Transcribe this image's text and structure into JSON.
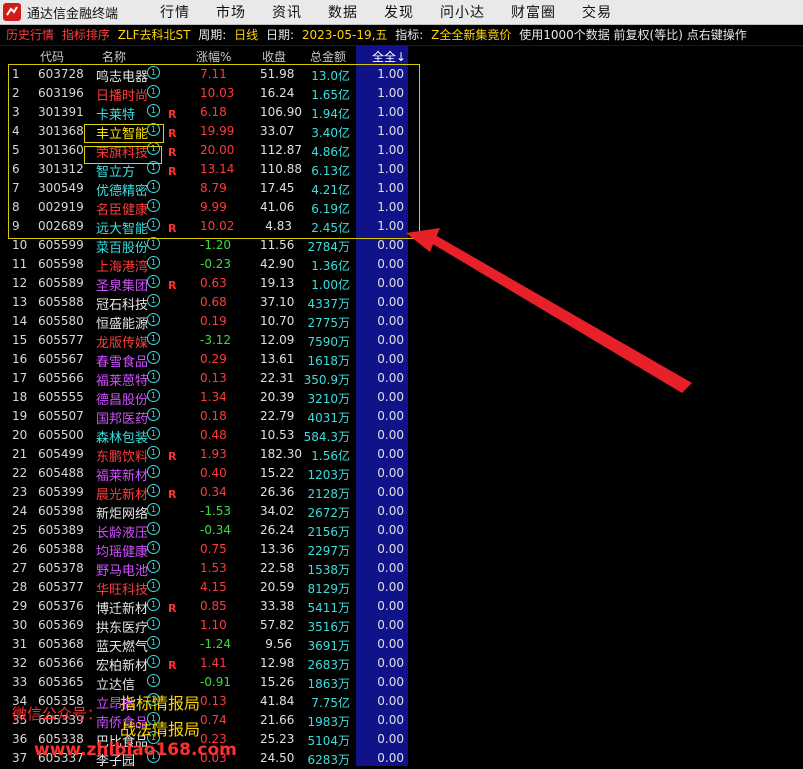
{
  "app": {
    "title": "通达信金融终端"
  },
  "menu": [
    "行情",
    "市场",
    "资讯",
    "数据",
    "发现",
    "问小达",
    "财富圈",
    "交易"
  ],
  "infobar": {
    "history": "历史行情",
    "sort": "指标排序",
    "indicator_name": "ZLF去科北ST",
    "period_label": "周期:",
    "period_value": "日线",
    "date_label": "日期:",
    "date_value": "2023-05-19,五",
    "indicator_label": "指标:",
    "indicator_value": "Z全全新集竟价",
    "note": "使用1000个数据 前复权(等比) 点右键操作"
  },
  "columns": {
    "code": "代码",
    "name": "名称",
    "chg": "涨幅%",
    "close": "收盘",
    "amount": "总金额",
    "all": "全全↓"
  },
  "rows": [
    {
      "n": "1",
      "code": "603728",
      "name": "鸣志电器",
      "nc": "#e6e6e6",
      "chg": "7.11",
      "up": true,
      "close": "51.98",
      "amt": "13.0亿",
      "all": "1.00",
      "r": false
    },
    {
      "n": "2",
      "code": "603196",
      "name": "日播时尚",
      "nc": "#ff3b3b",
      "chg": "10.03",
      "up": true,
      "close": "16.24",
      "amt": "1.65亿",
      "all": "1.00",
      "r": false
    },
    {
      "n": "3",
      "code": "301391",
      "name": "卡莱特",
      "nc": "#3cdede",
      "chg": "6.18",
      "up": true,
      "close": "106.90",
      "amt": "1.94亿",
      "all": "1.00",
      "r": true
    },
    {
      "n": "4",
      "code": "301368",
      "name": "丰立智能",
      "nc": "#ffe600",
      "chg": "19.99",
      "up": true,
      "close": "33.07",
      "amt": "3.40亿",
      "all": "1.00",
      "r": true
    },
    {
      "n": "5",
      "code": "301360",
      "name": "荣旗科技",
      "nc": "#ff3b3b",
      "chg": "20.00",
      "up": true,
      "close": "112.87",
      "amt": "4.86亿",
      "all": "1.00",
      "r": true
    },
    {
      "n": "6",
      "code": "301312",
      "name": "智立方",
      "nc": "#3cdede",
      "chg": "13.14",
      "up": true,
      "close": "110.88",
      "amt": "6.13亿",
      "all": "1.00",
      "r": true
    },
    {
      "n": "7",
      "code": "300549",
      "name": "优德精密",
      "nc": "#3cdede",
      "chg": "8.79",
      "up": true,
      "close": "17.45",
      "amt": "4.21亿",
      "all": "1.00",
      "r": false
    },
    {
      "n": "8",
      "code": "002919",
      "name": "名臣健康",
      "nc": "#ff3b3b",
      "chg": "9.99",
      "up": true,
      "close": "41.06",
      "amt": "6.19亿",
      "all": "1.00",
      "r": false
    },
    {
      "n": "9",
      "code": "002689",
      "name": "远大智能",
      "nc": "#3cdede",
      "chg": "10.02",
      "up": true,
      "close": "4.83",
      "amt": "2.45亿",
      "all": "1.00",
      "r": true
    },
    {
      "n": "10",
      "code": "605599",
      "name": "菜百股份",
      "nc": "#3cdede",
      "chg": "-1.20",
      "up": false,
      "close": "11.56",
      "amt": "2784万",
      "all": "0.00",
      "r": false
    },
    {
      "n": "11",
      "code": "605598",
      "name": "上海港湾",
      "nc": "#ff3b3b",
      "chg": "-0.23",
      "up": false,
      "close": "42.90",
      "amt": "1.36亿",
      "all": "0.00",
      "r": false
    },
    {
      "n": "12",
      "code": "605589",
      "name": "圣泉集团",
      "nc": "#d050ff",
      "chg": "0.63",
      "up": true,
      "close": "19.13",
      "amt": "1.00亿",
      "all": "0.00",
      "r": true
    },
    {
      "n": "13",
      "code": "605588",
      "name": "冠石科技",
      "nc": "#e6e6e6",
      "chg": "0.68",
      "up": true,
      "close": "37.10",
      "amt": "4337万",
      "all": "0.00",
      "r": false
    },
    {
      "n": "14",
      "code": "605580",
      "name": "恒盛能源",
      "nc": "#e6e6e6",
      "chg": "0.19",
      "up": true,
      "close": "10.70",
      "amt": "2775万",
      "all": "0.00",
      "r": false
    },
    {
      "n": "15",
      "code": "605577",
      "name": "龙版传媒",
      "nc": "#ff3b3b",
      "chg": "-3.12",
      "up": false,
      "close": "12.09",
      "amt": "7590万",
      "all": "0.00",
      "r": false
    },
    {
      "n": "16",
      "code": "605567",
      "name": "春雪食品",
      "nc": "#d050ff",
      "chg": "0.29",
      "up": true,
      "close": "13.61",
      "amt": "1618万",
      "all": "0.00",
      "r": false
    },
    {
      "n": "17",
      "code": "605566",
      "name": "福莱蒽特",
      "nc": "#d050ff",
      "chg": "0.13",
      "up": true,
      "close": "22.31",
      "amt": "350.9万",
      "all": "0.00",
      "r": false
    },
    {
      "n": "18",
      "code": "605555",
      "name": "德昌股份",
      "nc": "#d050ff",
      "chg": "1.34",
      "up": true,
      "close": "20.39",
      "amt": "3210万",
      "all": "0.00",
      "r": false
    },
    {
      "n": "19",
      "code": "605507",
      "name": "国邦医药",
      "nc": "#d050ff",
      "chg": "0.18",
      "up": true,
      "close": "22.79",
      "amt": "4031万",
      "all": "0.00",
      "r": false
    },
    {
      "n": "20",
      "code": "605500",
      "name": "森林包装",
      "nc": "#3cdede",
      "chg": "0.48",
      "up": true,
      "close": "10.53",
      "amt": "584.3万",
      "all": "0.00",
      "r": false
    },
    {
      "n": "21",
      "code": "605499",
      "name": "东鹏饮料",
      "nc": "#ff3b3b",
      "chg": "1.93",
      "up": true,
      "close": "182.30",
      "amt": "1.56亿",
      "all": "0.00",
      "r": true
    },
    {
      "n": "22",
      "code": "605488",
      "name": "福莱新材",
      "nc": "#d050ff",
      "chg": "0.40",
      "up": true,
      "close": "15.22",
      "amt": "1203万",
      "all": "0.00",
      "r": false
    },
    {
      "n": "23",
      "code": "605399",
      "name": "晨光新材",
      "nc": "#ff3b3b",
      "chg": "0.34",
      "up": true,
      "close": "26.36",
      "amt": "2128万",
      "all": "0.00",
      "r": true
    },
    {
      "n": "24",
      "code": "605398",
      "name": "新炬网络",
      "nc": "#e6e6e6",
      "chg": "-1.53",
      "up": false,
      "close": "34.02",
      "amt": "2672万",
      "all": "0.00",
      "r": false
    },
    {
      "n": "25",
      "code": "605389",
      "name": "长龄液压",
      "nc": "#d050ff",
      "chg": "-0.34",
      "up": false,
      "close": "26.24",
      "amt": "2156万",
      "all": "0.00",
      "r": false
    },
    {
      "n": "26",
      "code": "605388",
      "name": "均瑶健康",
      "nc": "#d050ff",
      "chg": "0.75",
      "up": true,
      "close": "13.36",
      "amt": "2297万",
      "all": "0.00",
      "r": false
    },
    {
      "n": "27",
      "code": "605378",
      "name": "野马电池",
      "nc": "#d050ff",
      "chg": "1.53",
      "up": true,
      "close": "22.58",
      "amt": "1538万",
      "all": "0.00",
      "r": false
    },
    {
      "n": "28",
      "code": "605377",
      "name": "华旺科技",
      "nc": "#ff3b3b",
      "chg": "4.15",
      "up": true,
      "close": "20.59",
      "amt": "8129万",
      "all": "0.00",
      "r": false
    },
    {
      "n": "29",
      "code": "605376",
      "name": "博迁新材",
      "nc": "#e6e6e6",
      "chg": "0.85",
      "up": true,
      "close": "33.38",
      "amt": "5411万",
      "all": "0.00",
      "r": true
    },
    {
      "n": "30",
      "code": "605369",
      "name": "拱东医疗",
      "nc": "#e6e6e6",
      "chg": "1.10",
      "up": true,
      "close": "57.82",
      "amt": "3516万",
      "all": "0.00",
      "r": false
    },
    {
      "n": "31",
      "code": "605368",
      "name": "蓝天燃气",
      "nc": "#e6e6e6",
      "chg": "-1.24",
      "up": false,
      "close": "9.56",
      "amt": "3691万",
      "all": "0.00",
      "r": false
    },
    {
      "n": "32",
      "code": "605366",
      "name": "宏柏新材",
      "nc": "#e6e6e6",
      "chg": "1.41",
      "up": true,
      "close": "12.98",
      "amt": "2683万",
      "all": "0.00",
      "r": true
    },
    {
      "n": "33",
      "code": "605365",
      "name": "立达信",
      "nc": "#e6e6e6",
      "chg": "-0.91",
      "up": false,
      "close": "15.26",
      "amt": "1863万",
      "all": "0.00",
      "r": false
    },
    {
      "n": "34",
      "code": "605358",
      "name": "立昂微",
      "nc": "#d050ff",
      "chg": "0.13",
      "up": true,
      "close": "41.84",
      "amt": "7.75亿",
      "all": "0.00",
      "r": false
    },
    {
      "n": "35",
      "code": "605339",
      "name": "南侨食品",
      "nc": "#d050ff",
      "chg": "0.74",
      "up": true,
      "close": "21.66",
      "amt": "1983万",
      "all": "0.00",
      "r": false
    },
    {
      "n": "36",
      "code": "605338",
      "name": "巴比食品",
      "nc": "#e6e6e6",
      "chg": "0.23",
      "up": true,
      "close": "25.23",
      "amt": "5104万",
      "all": "0.00",
      "r": false
    },
    {
      "n": "37",
      "code": "605337",
      "name": "李子园",
      "nc": "#e6e6e6",
      "chg": "0.03",
      "up": true,
      "close": "24.50",
      "amt": "6283万",
      "all": "0.00",
      "r": false
    }
  ],
  "overlay": {
    "wechat_label": "微信公众号：",
    "line1": "指标情报局",
    "line2": "战法情报局",
    "url": "www.zhibiao168.com",
    "colors": {
      "wechat": "#ff3030",
      "line": "#ffd400",
      "url": "#ff3030"
    }
  },
  "colors": {
    "up": "#ff3b3b",
    "down": "#3cdc3c",
    "circle": "#3cdede",
    "r_flag": "#ff3030",
    "highlight_box": "#d8c800"
  }
}
